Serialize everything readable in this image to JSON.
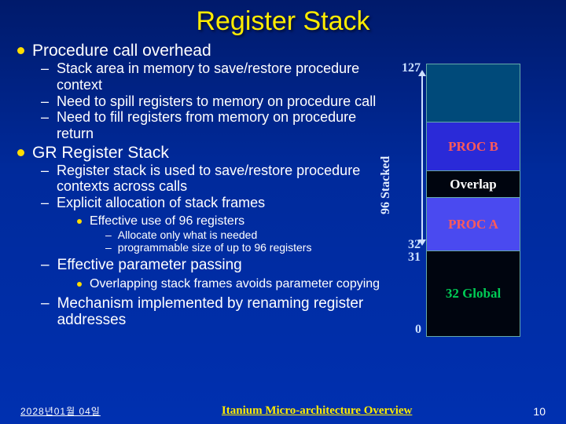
{
  "title": "Register Stack",
  "sec1": {
    "heading": "Procedure call overhead",
    "items": [
      "Stack area in memory to save/restore procedure context",
      "Need to spill registers to memory on procedure call",
      "Need to fill registers from memory on procedure return"
    ]
  },
  "sec2": {
    "heading": "GR Register Stack",
    "items": [
      "Register stack is used to save/restore procedure contexts across calls",
      "Explicit allocation of stack frames"
    ],
    "sub_effective": {
      "label": "Effective use of 96 registers",
      "items": [
        "Allocate only what is needed",
        "programmable size of up to 96 registers"
      ]
    },
    "param": {
      "label": "Effective parameter passing",
      "sub": "Overlapping stack frames avoids parameter copying"
    },
    "mech": "Mechanism implemented by renaming register addresses"
  },
  "diagram": {
    "ylabel": "96 Stacked",
    "labels": {
      "n127": "127",
      "n32": "32",
      "n31": "31",
      "n0": "0"
    },
    "segments": {
      "procb": "PROC B",
      "overlap": "Overlap",
      "proca": "PROC A",
      "global": "32 Global"
    }
  },
  "footer": {
    "date": "2028년01월 04일",
    "center": "Itanium Micro-architecture Overview",
    "page": "10"
  }
}
